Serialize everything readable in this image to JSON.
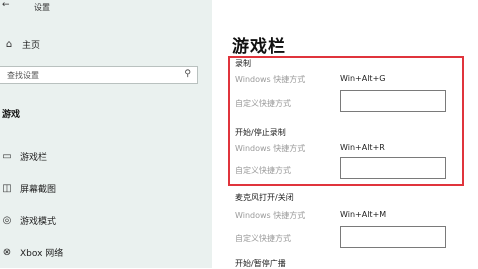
{
  "window": {
    "title": "设置"
  },
  "sidebar": {
    "home": "主页",
    "search_placeholder": "查找设置",
    "section": "游戏",
    "items": [
      {
        "label": "游戏栏",
        "icon": "game-bar-icon"
      },
      {
        "label": "屏幕截图",
        "icon": "capture-icon"
      },
      {
        "label": "游戏模式",
        "icon": "game-mode-icon"
      },
      {
        "label": "Xbox 网络",
        "icon": "xbox-icon"
      }
    ]
  },
  "main": {
    "title": "游戏栏",
    "groups": [
      {
        "title": "录制",
        "shortcut_label": "Windows 快捷方式",
        "shortcut": "Win+Alt+G",
        "custom_label": "自定义快捷方式",
        "custom_value": ""
      },
      {
        "title": "开始/停止录制",
        "shortcut_label": "Windows 快捷方式",
        "shortcut": "Win+Alt+R",
        "custom_label": "自定义快捷方式",
        "custom_value": ""
      },
      {
        "title": "麦克风打开/关闭",
        "shortcut_label": "Windows 快捷方式",
        "shortcut": "Win+Alt+M",
        "custom_label": "自定义快捷方式",
        "custom_value": ""
      },
      {
        "title": "开始/暂停广播"
      }
    ]
  },
  "colors": {
    "highlight_box": "#e0343c",
    "sidebar_bg": "#eaf1ef"
  }
}
